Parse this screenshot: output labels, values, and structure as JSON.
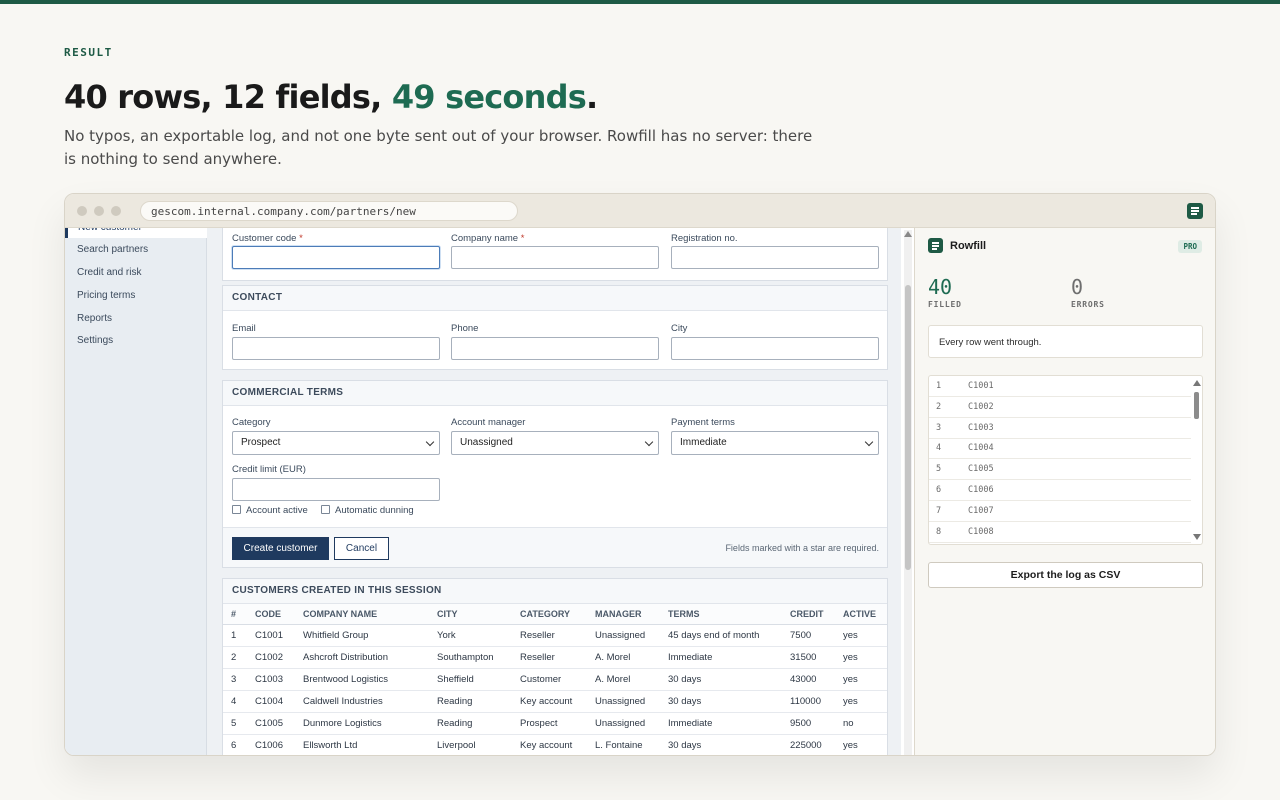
{
  "hero": {
    "eyebrow": "RESULT",
    "headline_main": "40 rows, 12 fields, ",
    "headline_accent": "49 seconds",
    "headline_end": ".",
    "subtitle": "No typos, an exportable log, and not one byte sent out of your browser. Rowfill has no server: there is nothing to send anywhere."
  },
  "browser": {
    "url": "gescom.internal.company.com/partners/new",
    "extension_icon": "rowfill-icon"
  },
  "sidebar": {
    "active_item": "New customer",
    "items": [
      "Search partners",
      "Credit and risk",
      "Pricing terms",
      "Reports",
      "Settings"
    ]
  },
  "form": {
    "identity": {
      "customer_code_label": "Customer code",
      "company_name_label": "Company name",
      "registration_label": "Registration no.",
      "required_mark": "*"
    },
    "contact": {
      "title": "CONTACT",
      "email_label": "Email",
      "phone_label": "Phone",
      "city_label": "City"
    },
    "commercial": {
      "title": "COMMERCIAL TERMS",
      "category_label": "Category",
      "category_value": "Prospect",
      "manager_label": "Account manager",
      "manager_value": "Unassigned",
      "payment_label": "Payment terms",
      "payment_value": "Immediate",
      "credit_label": "Credit limit (EUR)",
      "account_active_label": "Account active",
      "auto_dunning_label": "Automatic dunning"
    },
    "actions": {
      "create_label": "Create customer",
      "cancel_label": "Cancel",
      "required_note": "Fields marked with a star are required."
    }
  },
  "session_table": {
    "title": "CUSTOMERS CREATED IN THIS SESSION",
    "columns": [
      "#",
      "CODE",
      "COMPANY NAME",
      "CITY",
      "CATEGORY",
      "MANAGER",
      "TERMS",
      "CREDIT",
      "ACTIVE"
    ],
    "rows": [
      [
        "1",
        "C1001",
        "Whitfield Group",
        "York",
        "Reseller",
        "Unassigned",
        "45 days end of month",
        "7500",
        "yes"
      ],
      [
        "2",
        "C1002",
        "Ashcroft Distribution",
        "Southampton",
        "Reseller",
        "A. Morel",
        "Immediate",
        "31500",
        "yes"
      ],
      [
        "3",
        "C1003",
        "Brentwood Logistics",
        "Sheffield",
        "Customer",
        "A. Morel",
        "30 days",
        "43000",
        "yes"
      ],
      [
        "4",
        "C1004",
        "Caldwell Industries",
        "Reading",
        "Key account",
        "Unassigned",
        "30 days",
        "110000",
        "yes"
      ],
      [
        "5",
        "C1005",
        "Dunmore Logistics",
        "Reading",
        "Prospect",
        "Unassigned",
        "Immediate",
        "9500",
        "no"
      ],
      [
        "6",
        "C1006",
        "Ellsworth Ltd",
        "Liverpool",
        "Key account",
        "L. Fontaine",
        "30 days",
        "225000",
        "yes"
      ]
    ]
  },
  "rowfill": {
    "name": "Rowfill",
    "badge": "PRO",
    "filled_count": "40",
    "filled_label": "FILLED",
    "errors_count": "0",
    "errors_label": "ERRORS",
    "message": "Every row went through.",
    "log": [
      [
        "1",
        "C1001"
      ],
      [
        "2",
        "C1002"
      ],
      [
        "3",
        "C1003"
      ],
      [
        "4",
        "C1004"
      ],
      [
        "5",
        "C1005"
      ],
      [
        "6",
        "C1006"
      ],
      [
        "7",
        "C1007"
      ],
      [
        "8",
        "C1008"
      ]
    ],
    "export_label": "Export the log as CSV",
    "colors": {
      "brand": "#1e5a45",
      "accent": "#1e6b52"
    }
  }
}
